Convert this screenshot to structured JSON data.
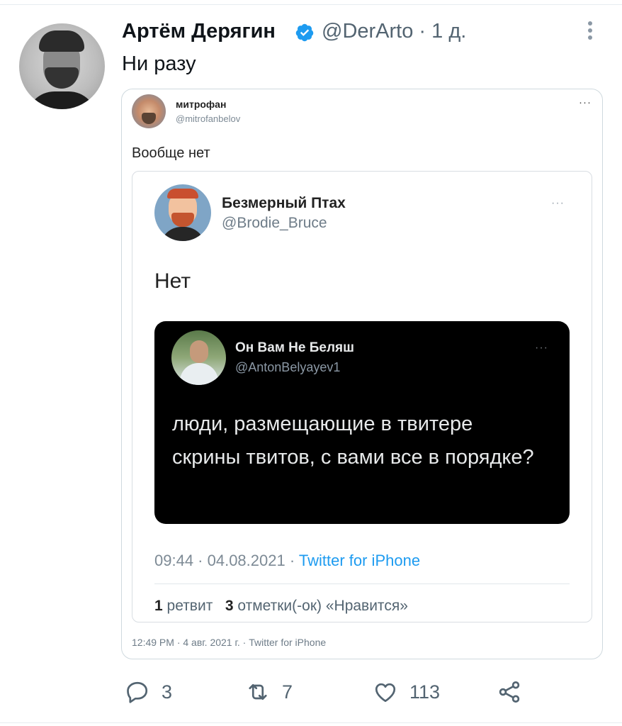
{
  "tweet": {
    "author_name": "Артём Дерягин",
    "handle": "@DerArto",
    "time": "· 1 д.",
    "text": "Ни разу"
  },
  "quote_level1": {
    "author_name": "митрофан",
    "handle": "@mitrofanbelov",
    "more": "···",
    "text": "Вообще нет",
    "footer": "12:49 PM · 4 авг. 2021 г. · Twitter for iPhone"
  },
  "quote_level2": {
    "author_name": "Безмерный Птах",
    "handle": "@Brodie_Bruce",
    "more": "···",
    "text": "Нет",
    "time": "09:44 · 04.08.2021 · ",
    "source": "Twitter for iPhone",
    "retweets_count": "1",
    "retweets_label": "ретвит",
    "likes_count": "3",
    "likes_label": "отметки(-ок) «Нравится»"
  },
  "quote_level3": {
    "author_name": "Он Вам Не Беляш",
    "handle": "@AntonBelyayev1",
    "more": "···",
    "text": "люди, размещающие в твитере скрины твитов, с вами все в порядке?"
  },
  "actions": {
    "reply_count": "3",
    "retweet_count": "7",
    "like_count": "113"
  },
  "icons": {
    "verified": "verified-badge-icon",
    "more": "more-vertical-icon",
    "reply": "reply-icon",
    "retweet": "retweet-icon",
    "like": "heart-icon",
    "share": "share-icon"
  },
  "colors": {
    "accent": "#1d9bf0",
    "text": "#0f1419",
    "muted": "#536471",
    "dark_card": "#000000"
  }
}
